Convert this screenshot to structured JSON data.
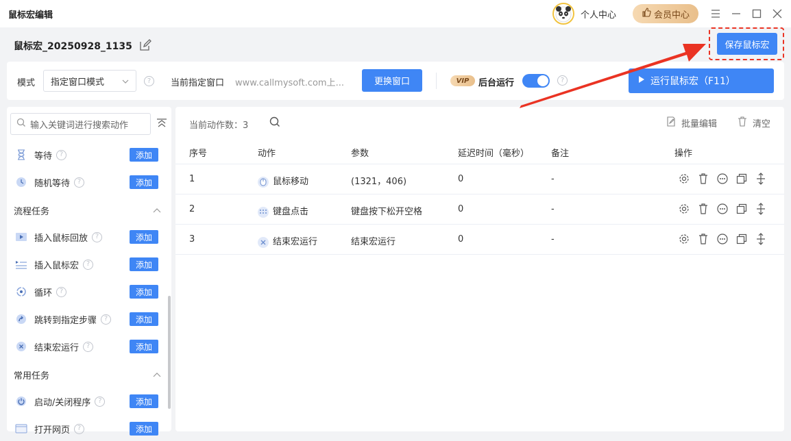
{
  "app": {
    "title": "鼠标宏编辑"
  },
  "header": {
    "user_center": "个人中心",
    "vip_center": "会员中心"
  },
  "macro": {
    "name": "鼠标宏_20250928_1135",
    "save_label": "保存鼠标宏"
  },
  "toolbar": {
    "mode_label": "模式",
    "mode_value": "指定窗口模式",
    "current_window_label": "当前指定窗口",
    "current_window_value": "www.callmysoft.com上...",
    "change_window_label": "更换窗口",
    "vip_badge": "VIP",
    "background_run_label": "后台运行",
    "background_run_on": true,
    "run_label": "运行鼠标宏（F11）"
  },
  "sidebar": {
    "search_placeholder": "输入关键词进行搜索动作",
    "add_label": "添加",
    "items_top": [
      {
        "label": "等待",
        "icon": "hourglass-icon"
      },
      {
        "label": "随机等待",
        "icon": "clock-icon"
      }
    ],
    "sections": [
      {
        "title": "流程任务",
        "items": [
          {
            "label": "插入鼠标回放",
            "icon": "playback-icon"
          },
          {
            "label": "插入鼠标宏",
            "icon": "macro-list-icon"
          },
          {
            "label": "循环",
            "icon": "loop-icon"
          },
          {
            "label": "跳转到指定步骤",
            "icon": "jump-icon"
          },
          {
            "label": "结束宏运行",
            "icon": "stop-icon"
          }
        ]
      },
      {
        "title": "常用任务",
        "items": [
          {
            "label": "启动/关闭程序",
            "icon": "power-icon"
          },
          {
            "label": "打开网页",
            "icon": "browser-icon"
          }
        ]
      }
    ]
  },
  "main": {
    "count_label": "当前动作数：",
    "count_value": "3",
    "batch_edit_label": "批量编辑",
    "clear_label": "清空",
    "columns": [
      "序号",
      "动作",
      "参数",
      "延迟时间（毫秒）",
      "备注",
      "操作"
    ],
    "rows": [
      {
        "index": "1",
        "action": "鼠标移动",
        "action_icon": "mouse-icon",
        "param": "(1321，406)",
        "delay": "0",
        "note": "-"
      },
      {
        "index": "2",
        "action": "键盘点击",
        "action_icon": "keyboard-icon",
        "param": "键盘按下松开空格",
        "delay": "0",
        "note": "-"
      },
      {
        "index": "3",
        "action": "结束宏运行",
        "action_icon": "stop-icon",
        "param": "结束宏运行",
        "delay": "0",
        "note": "-"
      }
    ]
  },
  "colors": {
    "primary": "#3f86f5",
    "highlight": "#ea3323",
    "vip_gold": "#e9bf8b"
  }
}
